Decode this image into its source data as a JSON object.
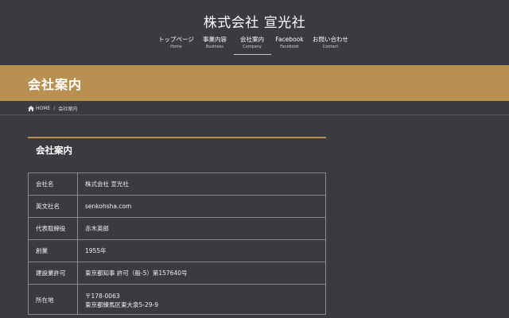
{
  "site": {
    "title": "株式会社 宣光社"
  },
  "nav": [
    {
      "label": "トップページ",
      "sub": "Home"
    },
    {
      "label": "事業内容",
      "sub": "Business"
    },
    {
      "label": "会社案内",
      "sub": "Company"
    },
    {
      "label": "Facebook",
      "sub": "Facebook"
    },
    {
      "label": "お問い合わせ",
      "sub": "Contact"
    }
  ],
  "nav_active_index": 2,
  "page": {
    "title": "会社案内"
  },
  "breadcrumb": {
    "home": "HOME",
    "current": "会社案内",
    "home_icon": "home-icon"
  },
  "section": {
    "title": "会社案内"
  },
  "company_table": [
    {
      "key": "会社名",
      "value": "株式会社 宣光社"
    },
    {
      "key": "英文社名",
      "value": "senkohsha.com"
    },
    {
      "key": "代表取締役",
      "value": "赤木英郎"
    },
    {
      "key": "創業",
      "value": "1955年"
    },
    {
      "key": "建設業許可",
      "value": "東京都知事 許可（般-5）第157640号"
    },
    {
      "key": "所在地",
      "value_line1": "〒178-0063",
      "value_line2": "東京都練馬区東大泉5-29-9"
    }
  ],
  "colors": {
    "background": "#3a3b40",
    "accent": "#b89052",
    "border": "#8a8b90"
  }
}
